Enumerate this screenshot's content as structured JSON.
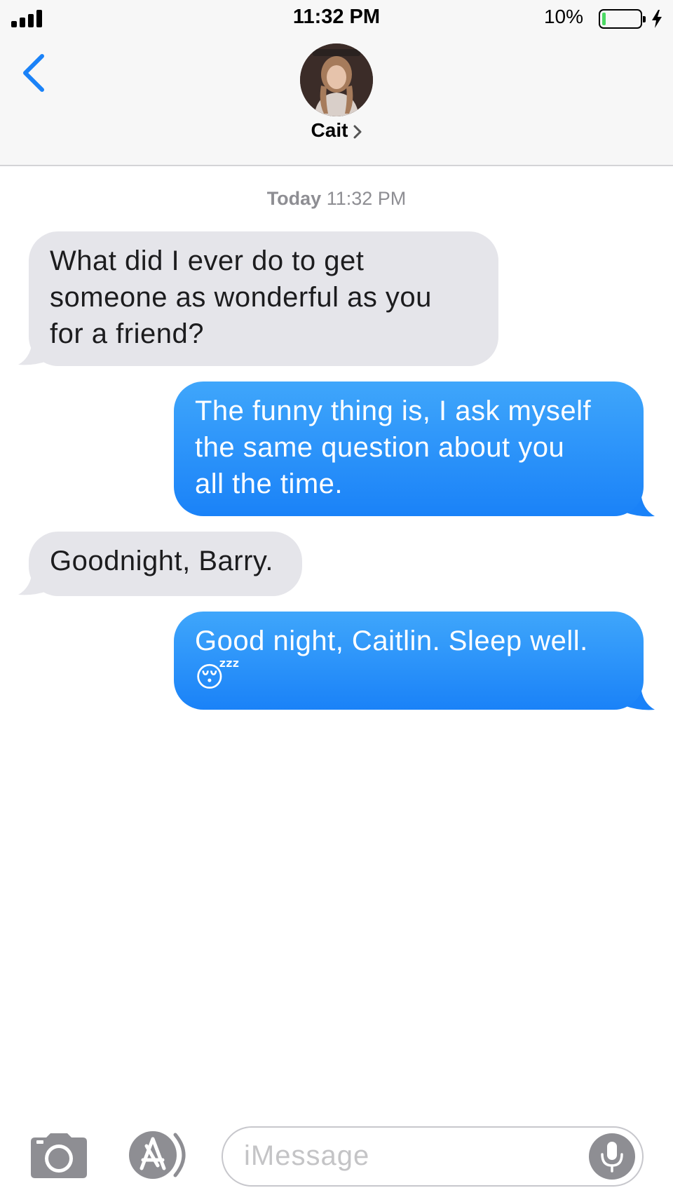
{
  "status_bar": {
    "time": "11:32 PM",
    "battery_percent_label": "10%",
    "battery_level": 0.1,
    "signal_bars": 4,
    "charging": true
  },
  "header": {
    "contact_name": "Cait",
    "back_icon": "chevron-left-icon",
    "accent_color": "#1a82f8"
  },
  "conversation": {
    "timestamp_day": "Today",
    "timestamp_time": "11:32 PM",
    "messages": [
      {
        "direction": "incoming",
        "lines": [
          "What did I ever do to get",
          "someone as wonderful as you",
          "for a friend?"
        ]
      },
      {
        "direction": "outgoing",
        "lines": [
          "The funny thing is, I ask myself",
          "the same question about you",
          "all the time."
        ]
      },
      {
        "direction": "incoming",
        "lines": [
          "Goodnight, Barry."
        ]
      },
      {
        "direction": "outgoing",
        "lines": [
          "Good night, Caitlin. Sleep well.",
          "😴"
        ]
      }
    ]
  },
  "input_bar": {
    "placeholder": "iMessage",
    "camera_icon": "camera-icon",
    "apps_icon": "app-store-icon",
    "mic_icon": "microphone-icon"
  }
}
